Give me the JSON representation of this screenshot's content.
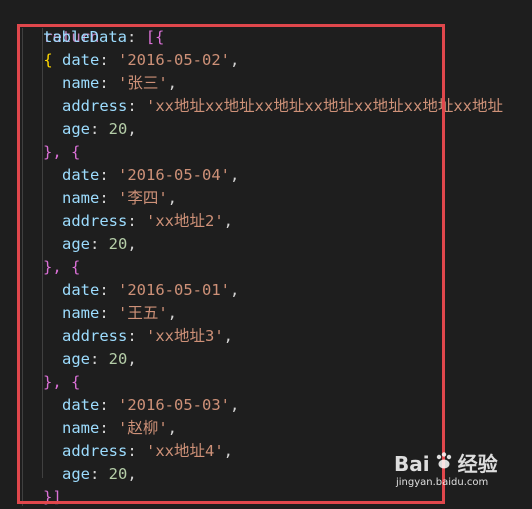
{
  "code": {
    "return_kw": "return",
    "open_brace": "{",
    "table_prop": "tableData",
    "colon": ":",
    "open_array": "[{",
    "rows": [
      {
        "date": "'2016-05-02'",
        "name": "'张三'",
        "address": "'xx地址xx地址xx地址xx地址xx地址xx地址xx地址",
        "age": "20"
      },
      {
        "date": "'2016-05-04'",
        "name": "'李四'",
        "address": "'xx地址2'",
        "age": "20"
      },
      {
        "date": "'2016-05-01'",
        "name": "'王五'",
        "address": "'xx地址3'",
        "age": "20"
      },
      {
        "date": "'2016-05-03'",
        "name": "'赵柳'",
        "address": "'xx地址4'",
        "age": "20"
      }
    ],
    "keys": {
      "date": "date",
      "name": "name",
      "address": "address",
      "age": "age"
    },
    "row_sep": "}, {",
    "close_array": "}]"
  },
  "watermark": {
    "brand": "Bai",
    "brand_suffix": "经验",
    "url": "jingyan.baidu.com"
  },
  "colors": {
    "highlight_box": "#e0474c",
    "background": "#1e1e1e"
  },
  "icons": {
    "watermark_logo": "baidu-paw-icon"
  }
}
